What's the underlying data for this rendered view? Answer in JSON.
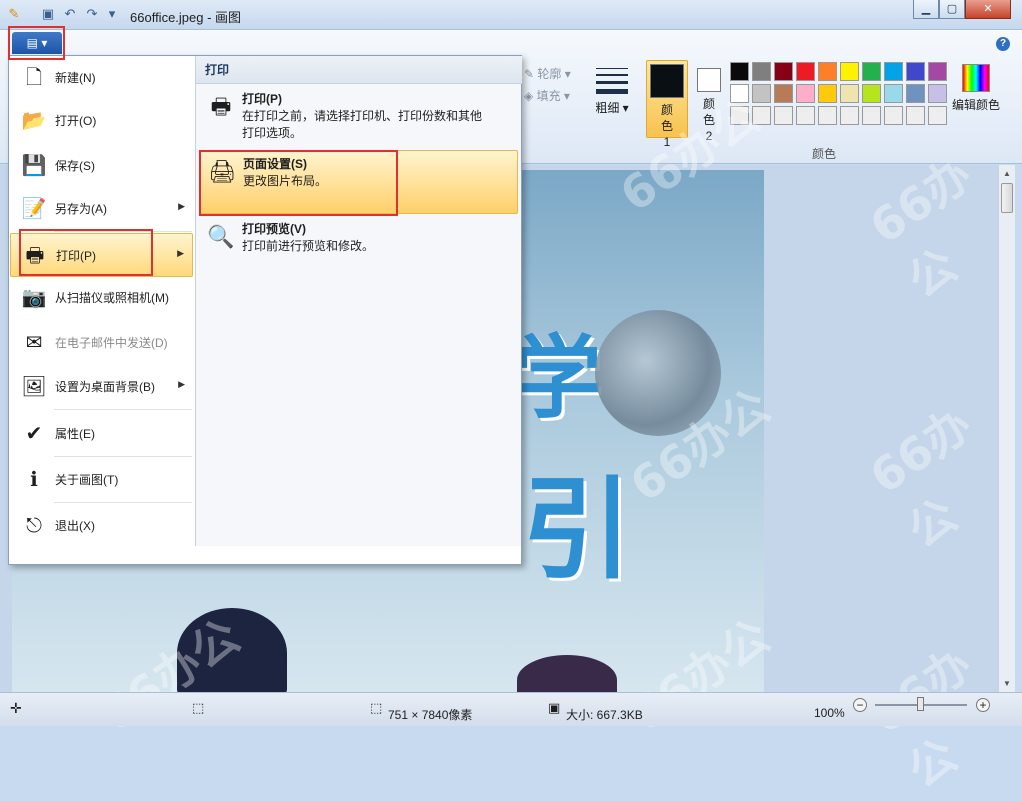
{
  "window": {
    "title": "66office.jpeg - 画图",
    "min": "▁",
    "max": "▢",
    "close": "✕"
  },
  "quick_access": {
    "app_icon": "paint-icon",
    "save_icon": "floppy-icon",
    "undo_icon": "undo-icon",
    "redo_icon": "redo-icon",
    "more": "▾"
  },
  "ribbon": {
    "app_tab": "▤ ▾",
    "help": "?",
    "outline": "轮廓",
    "fill": "填充",
    "thickness": "粗细",
    "color1": "颜色 1",
    "color2": "颜色 2",
    "edit_colors": "编辑颜色",
    "group_colors": "颜色",
    "color1_value": "#0a0f14",
    "color2_value": "#ffffff",
    "palette": [
      "#0a0a0a",
      "#7f7f7f",
      "#880015",
      "#ed1c24",
      "#ff7f27",
      "#fff200",
      "#22b14c",
      "#00a2e8",
      "#3f48cc",
      "#a349a4",
      "#ffffff",
      "#c3c3c3",
      "#b97a57",
      "#ffaec9",
      "#ffc90e",
      "#efe4b0",
      "#b5e61d",
      "#99d9ea",
      "#7092be",
      "#c8bfe7",
      "#eeeeee",
      "#eeeeee",
      "#eeeeee",
      "#eeeeee",
      "#eeeeee",
      "#eeeeee",
      "#eeeeee",
      "#eeeeee",
      "#eeeeee",
      "#eeeeee"
    ]
  },
  "menu": {
    "left": [
      {
        "label": "新建(N)",
        "icon": "new-file-icon",
        "glyph": "🗋"
      },
      {
        "label": "打开(O)",
        "icon": "open-folder-icon",
        "glyph": "📂"
      },
      {
        "label": "保存(S)",
        "icon": "save-icon",
        "glyph": "💾"
      },
      {
        "label": "另存为(A)",
        "icon": "save-as-icon",
        "glyph": "📝",
        "sub": "▶"
      },
      {
        "label": "打印(P)",
        "icon": "printer-icon",
        "glyph": "🖶",
        "sub": "▶"
      },
      {
        "label": "从扫描仪或照相机(M)",
        "icon": "scanner-icon",
        "glyph": "📷"
      },
      {
        "label": "在电子邮件中发送(D)",
        "icon": "email-icon",
        "glyph": "✉"
      },
      {
        "label": "设置为桌面背景(B)",
        "icon": "desktop-background-icon",
        "glyph": "🖼",
        "sub": "▶"
      },
      {
        "label": "属性(E)",
        "icon": "checkmark-icon",
        "glyph": "✔"
      },
      {
        "label": "关于画图(T)",
        "icon": "info-icon",
        "glyph": "ℹ"
      },
      {
        "label": "退出(X)",
        "icon": "exit-icon",
        "glyph": "⎋"
      }
    ],
    "right_header": "打印",
    "right": [
      {
        "title": "打印(P)",
        "desc": "在打印之前，请选择打印机、打印份数和其他打印选项。",
        "icon": "printer-icon",
        "glyph": "🖶"
      },
      {
        "title": "页面设置(S)",
        "desc": "更改图片布局。",
        "icon": "page-setup-icon",
        "glyph": "🖨"
      },
      {
        "title": "打印预览(V)",
        "desc": "打印前进行预览和修改。",
        "icon": "print-preview-icon",
        "glyph": "🔍"
      }
    ]
  },
  "status": {
    "move_icon": "✛",
    "select_icon": "⬚",
    "dimensions": "751 × 7840像素",
    "size": "大小: 667.3KB",
    "zoom": "100%",
    "zoom_out": "−",
    "zoom_in": "+"
  },
  "image": {
    "text_top": "学",
    "text_bottom": "引"
  },
  "watermark": "66办公"
}
